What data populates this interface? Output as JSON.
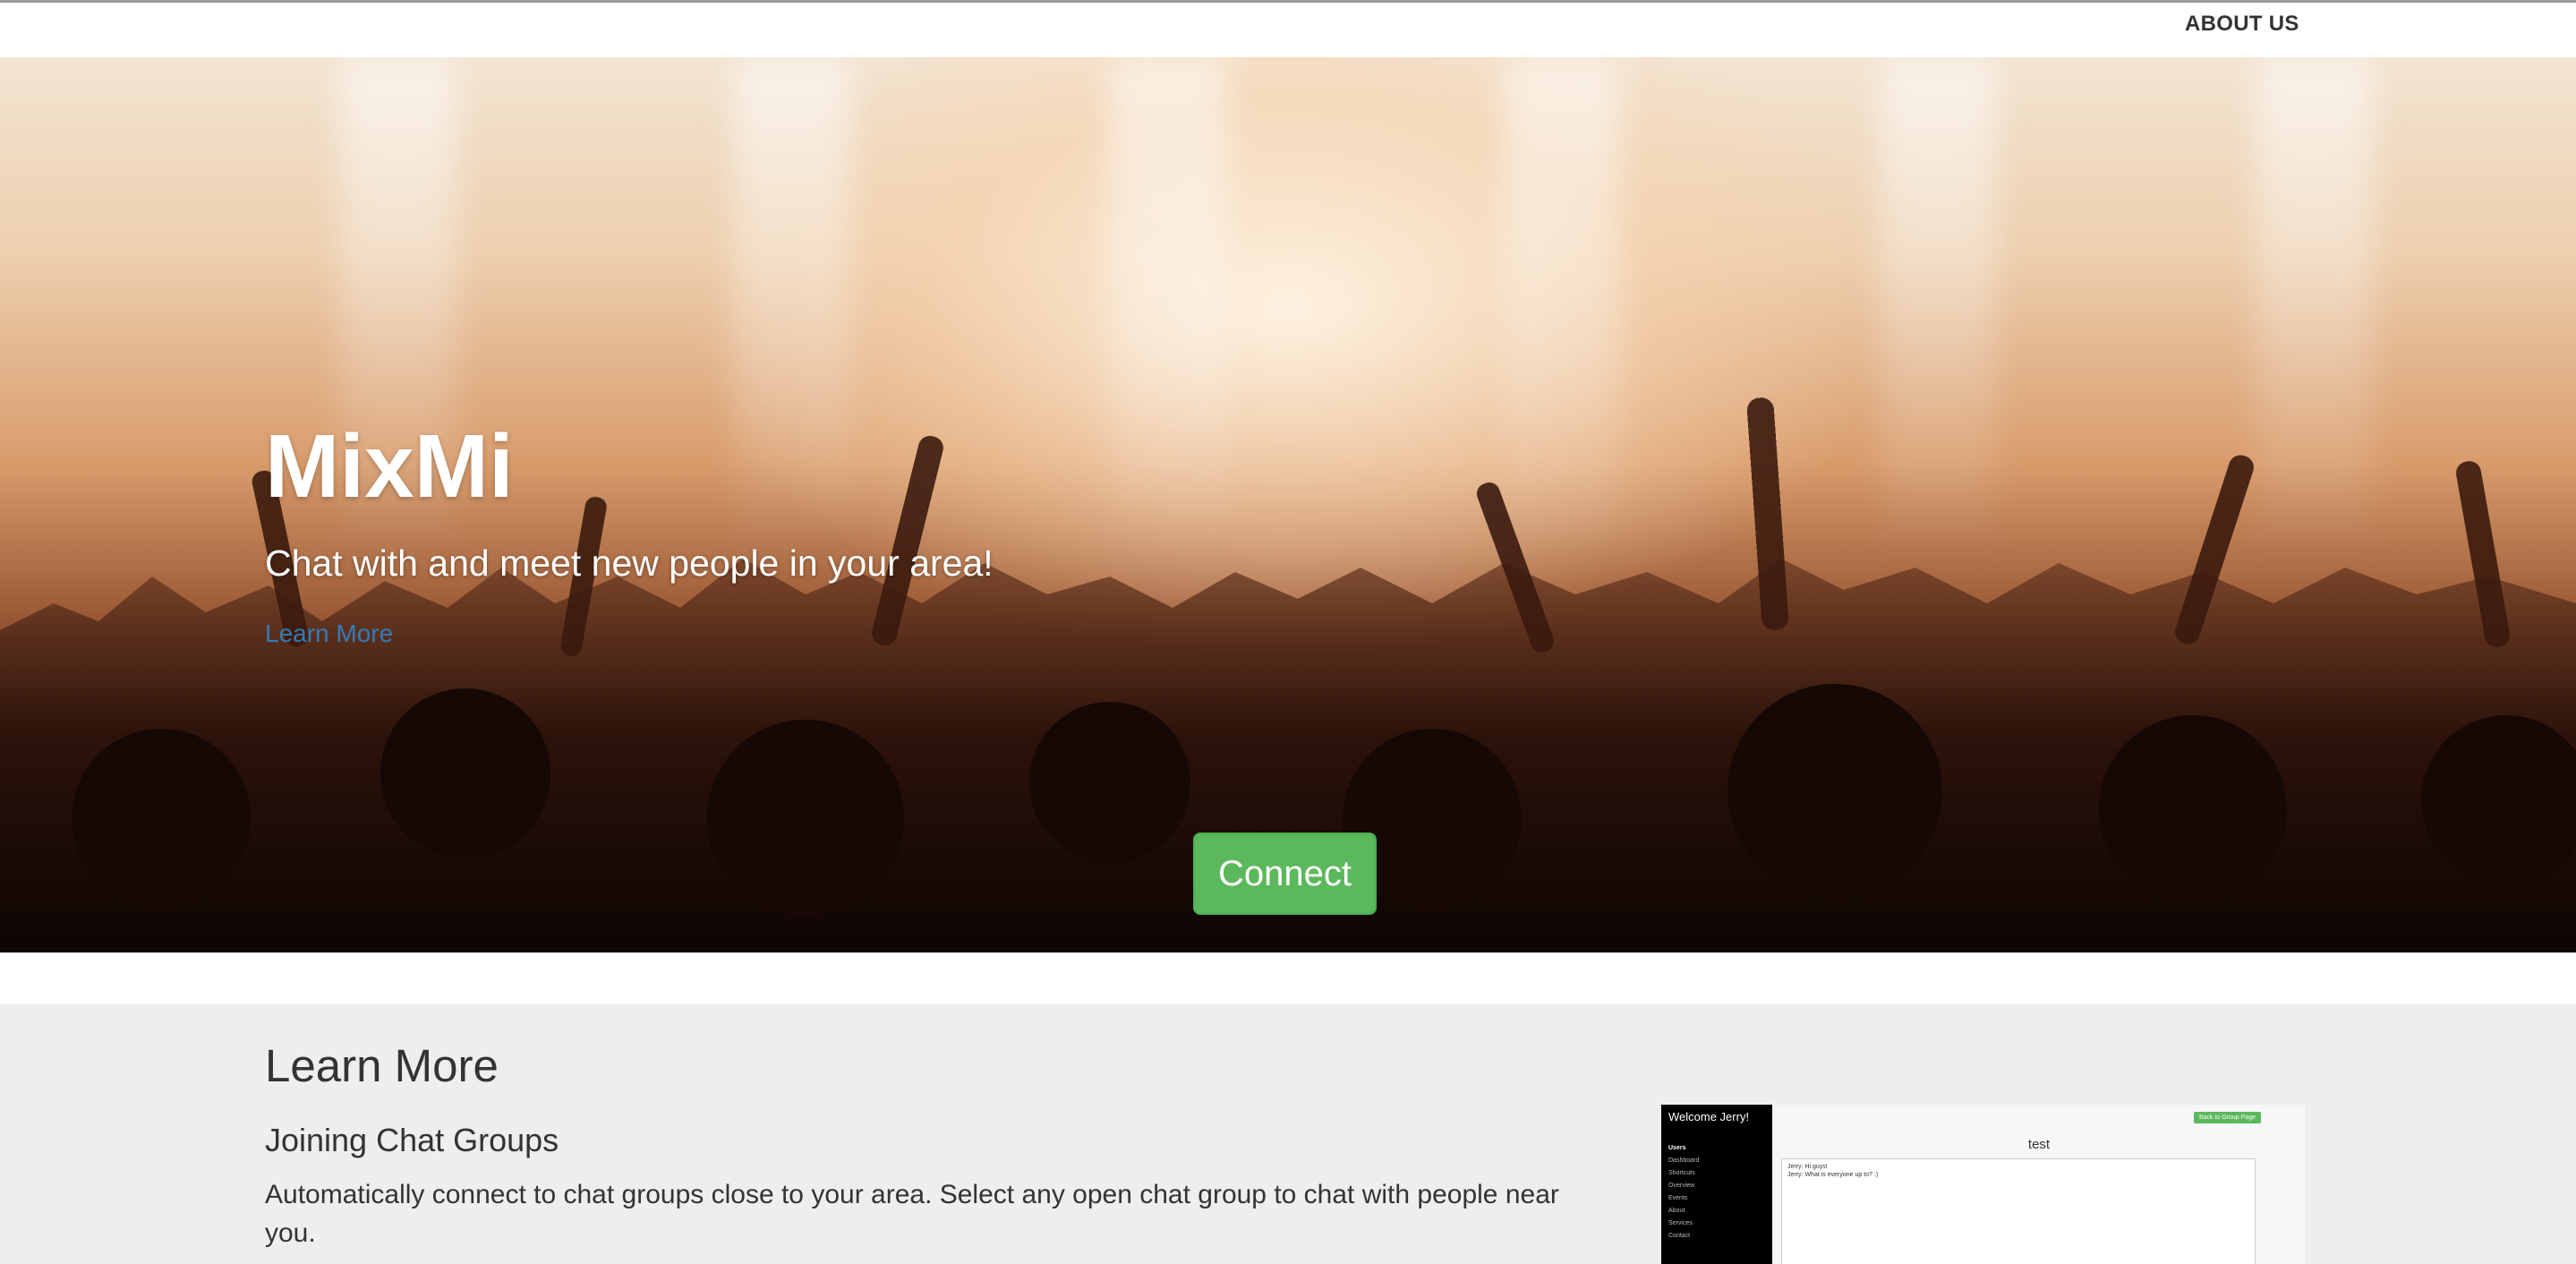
{
  "nav": {
    "about_label": "ABOUT US"
  },
  "hero": {
    "title": "MixMi",
    "subtitle": "Chat with and meet new people in your area!",
    "learn_more_link": "Learn More",
    "connect_label": "Connect"
  },
  "learn_more": {
    "heading": "Learn More",
    "feature_title": "Joining Chat Groups",
    "feature_text": "Automatically connect to chat groups close to your area. Select any open chat group to chat with people near you."
  },
  "preview": {
    "welcome": "Welcome Jerry!",
    "menu_header": "Users",
    "menu_items": [
      "Dashboard",
      "Shortcuts",
      "Overview",
      "Events",
      "About",
      "Services",
      "Contact"
    ],
    "back_button": "Back to Group Page",
    "room_title": "test",
    "messages": [
      "Jerry: Hi guys!",
      "Jerry: What is everyone up to? :)"
    ]
  },
  "colors": {
    "accent_green": "#5cb85c",
    "link_blue": "#337ab7",
    "section_gray": "#eeeeee",
    "text_dark": "#333333"
  }
}
